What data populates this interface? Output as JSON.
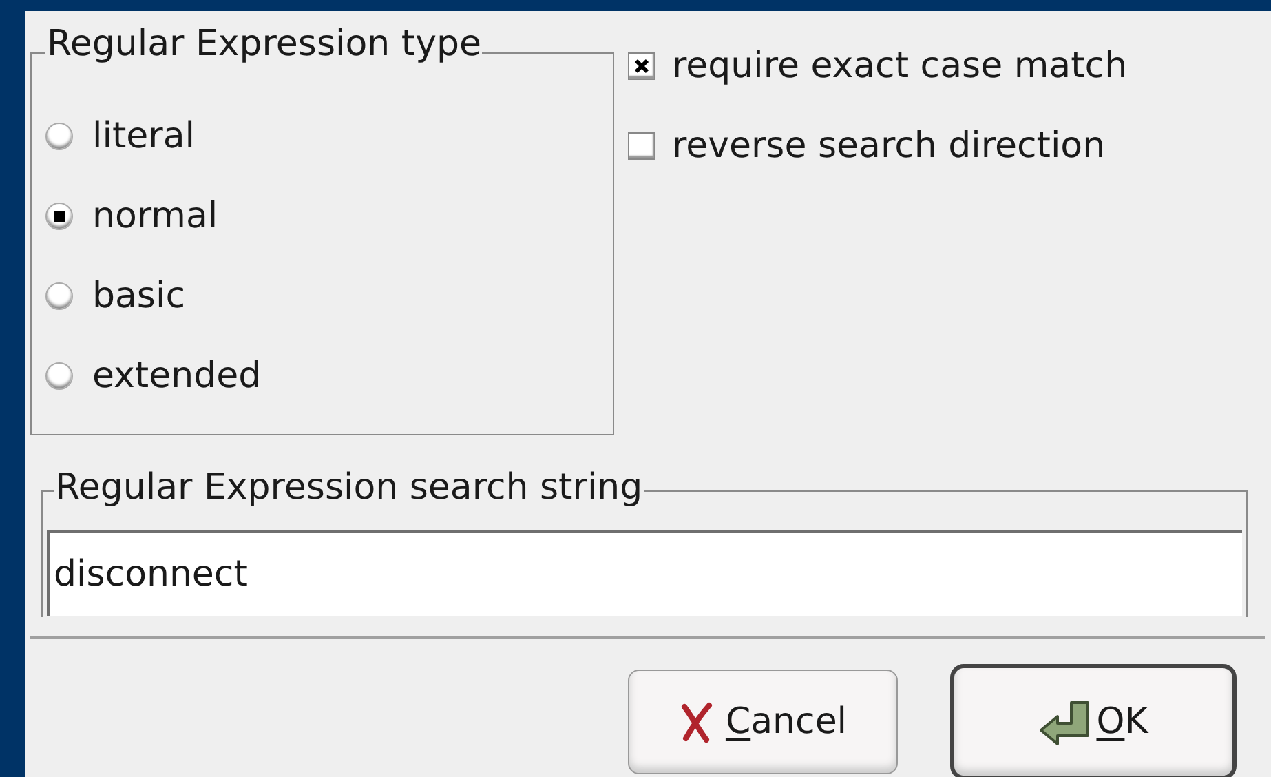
{
  "regex_type": {
    "title": "Regular Expression type",
    "options": [
      {
        "label": "literal",
        "selected": false
      },
      {
        "label": "normal",
        "selected": true
      },
      {
        "label": "basic",
        "selected": false
      },
      {
        "label": "extended",
        "selected": false
      }
    ]
  },
  "options": [
    {
      "label": "require exact case match",
      "checked": true
    },
    {
      "label": "reverse search direction",
      "checked": false
    }
  ],
  "search_string": {
    "title": "Regular Expression search string",
    "value": "disconnect"
  },
  "buttons": [
    {
      "kind": "cancel",
      "access_key": "C",
      "label_rest": "ancel",
      "default": false
    },
    {
      "kind": "ok",
      "access_key": "O",
      "label_rest": "K",
      "default": true
    }
  ]
}
